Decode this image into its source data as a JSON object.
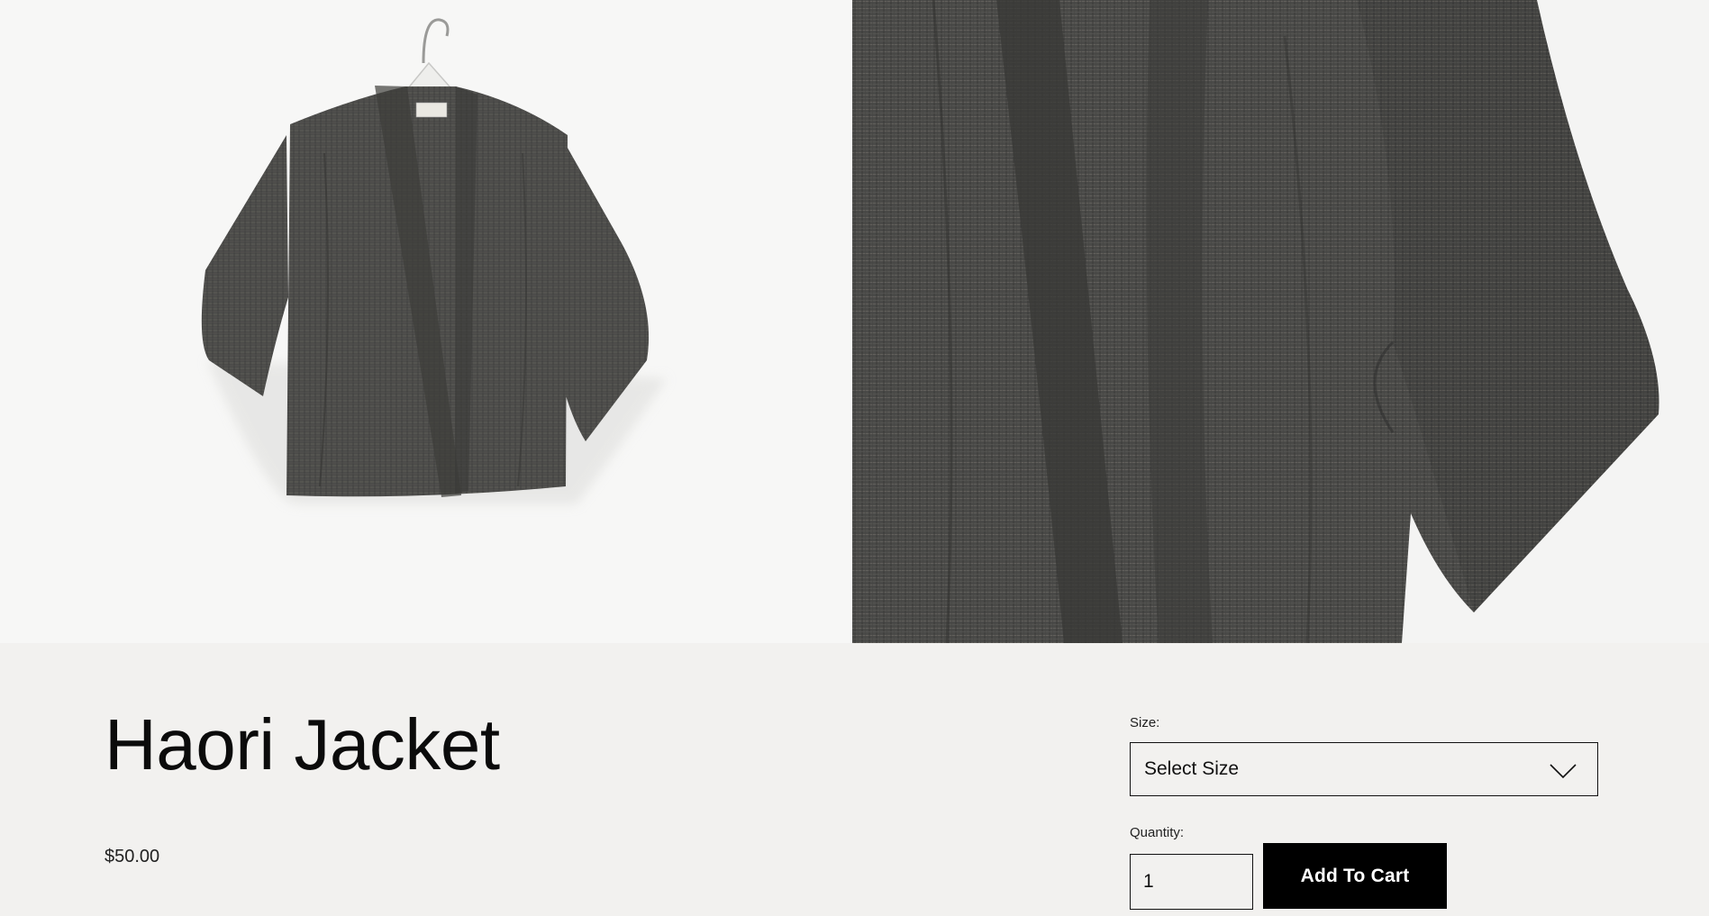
{
  "gallery": {
    "images": [
      {
        "alt": "",
        "icon": "jacket-on-hanger-photo"
      },
      {
        "alt": "",
        "icon": "jacket-fabric-closeup-photo"
      }
    ]
  },
  "product": {
    "title": "Haori Jacket",
    "price": "$50.00"
  },
  "size": {
    "label": "Size:",
    "selected": "Select Size"
  },
  "quantity": {
    "label": "Quantity:",
    "value": "1"
  },
  "cart": {
    "button_label": "Add To Cart"
  },
  "colors": {
    "page_background": "#f2f1ef",
    "button_background": "#000000",
    "button_text": "#ffffff",
    "fabric": "#4a4a48"
  }
}
